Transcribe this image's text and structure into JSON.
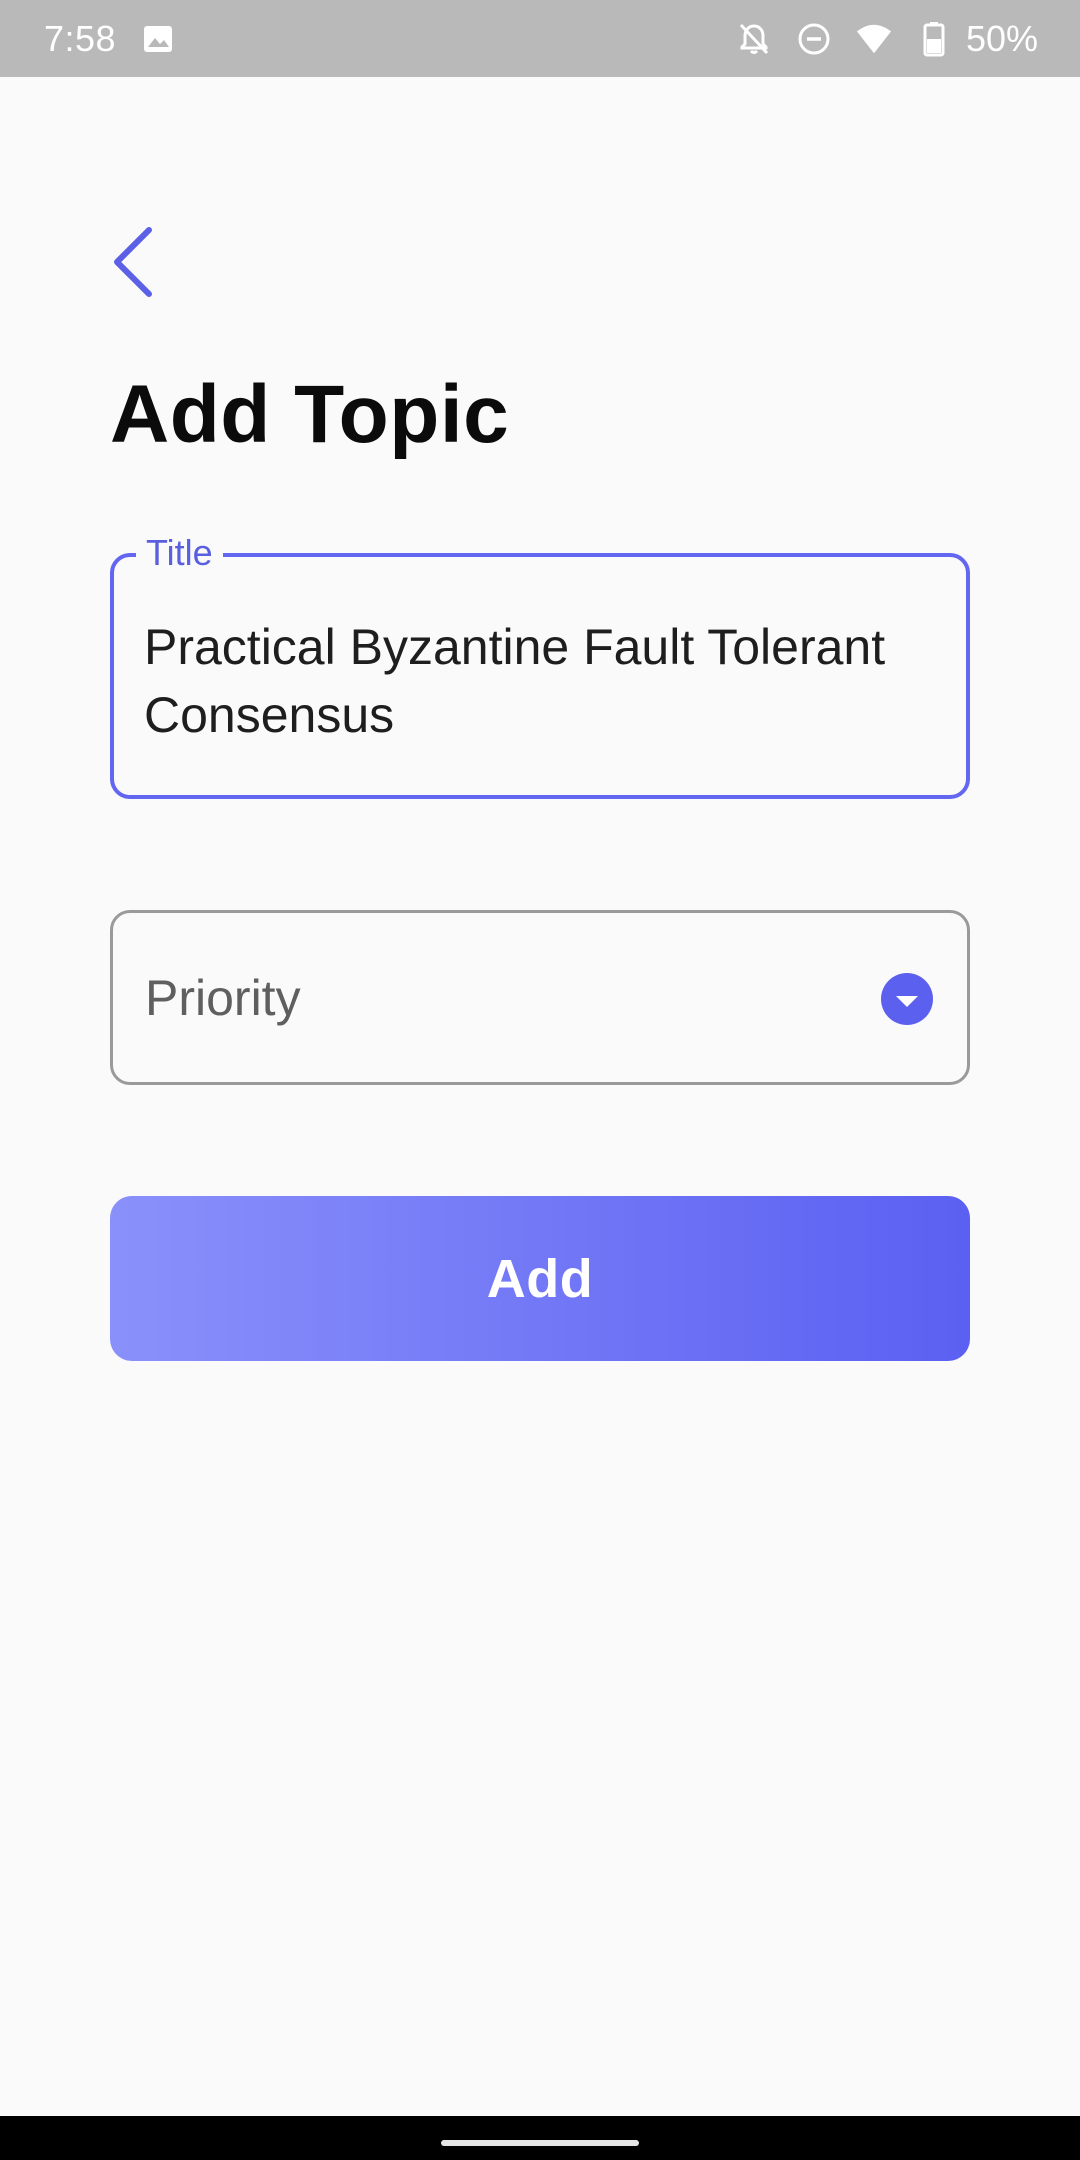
{
  "status_bar": {
    "time": "7:58",
    "battery": "50%",
    "icons": [
      "image-icon",
      "notifications-off-icon",
      "do-not-disturb-icon",
      "wifi-icon",
      "battery-icon"
    ]
  },
  "header": {
    "back_icon": "chevron-left-icon",
    "title": "Add Topic"
  },
  "form": {
    "title_field": {
      "label": "Title",
      "value": "Practical Byzantine Fault Tolerant Consensus"
    },
    "priority_field": {
      "placeholder": "Priority",
      "icon": "dropdown-arrow-icon"
    },
    "submit_label": "Add"
  },
  "colors": {
    "accent": "#6366f1",
    "button_gradient_start": "#8a90fa",
    "button_gradient_end": "#5b60f2",
    "status_bar": "#b9b9b9",
    "background": "#fafafa"
  }
}
